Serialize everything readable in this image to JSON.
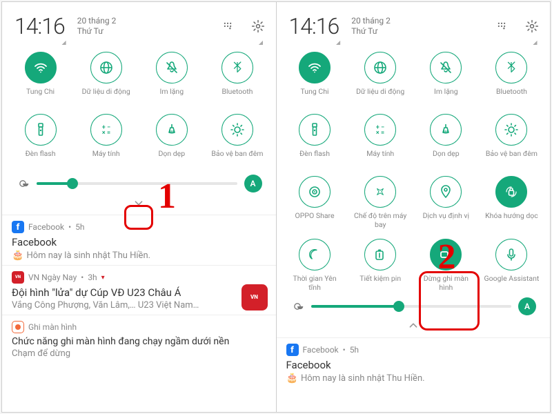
{
  "left": {
    "time": "14:16",
    "date_line1": "20 tháng 2",
    "date_line2": "Thứ Tư",
    "tiles": [
      {
        "label": "Tung Chi",
        "fill": true,
        "icon": "wifi"
      },
      {
        "label": "Dữ liệu di động",
        "fill": false,
        "icon": "globe"
      },
      {
        "label": "Im lặng",
        "fill": false,
        "icon": "silent"
      },
      {
        "label": "Bluetooth",
        "fill": false,
        "icon": "bluetooth"
      },
      {
        "label": "Đèn flash",
        "fill": false,
        "icon": "flashlight"
      },
      {
        "label": "Máy tính",
        "fill": false,
        "icon": "calculator"
      },
      {
        "label": "Dọn dẹp",
        "fill": false,
        "icon": "broom"
      },
      {
        "label": "Bảo vệ ban đêm",
        "fill": false,
        "icon": "sun"
      }
    ],
    "brightness_pct": 18,
    "auto_label": "A",
    "notifs": [
      {
        "app": "Facebook",
        "time": "5h",
        "title": "Facebook",
        "body": "Hôm nay là sinh nhật Thu Hiền.",
        "kind": "fb"
      },
      {
        "app": "VN Ngày Nay",
        "time": "3h",
        "title": "Đội hình \"lửa\" dự Cúp VĐ U23 Châu Á",
        "body": "Vắng Công Phượng, Văn Lâm,… U23 Việt Nam…",
        "kind": "vn"
      },
      {
        "app": "Ghi màn hình",
        "title": "Chức năng ghi màn hình đang chạy ngầm dưới nền",
        "body": "Chạm để dừng",
        "kind": "rec"
      }
    ],
    "callout_num": "1"
  },
  "right": {
    "time": "14:16",
    "date_line1": "20 tháng 2",
    "date_line2": "Thứ Tư",
    "tiles": [
      {
        "label": "Tung Chi",
        "fill": true,
        "icon": "wifi"
      },
      {
        "label": "Dữ liệu di động",
        "fill": false,
        "icon": "globe"
      },
      {
        "label": "Im lặng",
        "fill": false,
        "icon": "silent"
      },
      {
        "label": "Bluetooth",
        "fill": false,
        "icon": "bluetooth"
      },
      {
        "label": "Đèn flash",
        "fill": false,
        "icon": "flashlight"
      },
      {
        "label": "Máy tính",
        "fill": false,
        "icon": "calculator"
      },
      {
        "label": "Dọn dẹp",
        "fill": false,
        "icon": "broom"
      },
      {
        "label": "Bảo vệ ban đêm",
        "fill": false,
        "icon": "sun"
      },
      {
        "label": "OPPO Share",
        "fill": false,
        "icon": "share"
      },
      {
        "label": "Chế độ trên máy\nbay",
        "fill": false,
        "icon": "airplane"
      },
      {
        "label": "Dịch vụ định vị",
        "fill": false,
        "icon": "location"
      },
      {
        "label": "Khóa hướng dọc",
        "fill": true,
        "icon": "lock-rotate"
      },
      {
        "label": "Thời gian Yên\ntĩnh",
        "fill": false,
        "icon": "moon"
      },
      {
        "label": "Tiết kiệm pin",
        "fill": false,
        "icon": "battery"
      },
      {
        "label": "Dừng ghi màn\nhình",
        "fill": true,
        "icon": "record"
      },
      {
        "label": "Google Assistant",
        "fill": false,
        "icon": "mic"
      }
    ],
    "brightness_pct": 44,
    "auto_label": "A",
    "notif": {
      "app": "Facebook",
      "time": "5h",
      "title": "Facebook",
      "body": "Hôm nay là sinh nhật Thu Hiền."
    },
    "callout_num": "2"
  }
}
